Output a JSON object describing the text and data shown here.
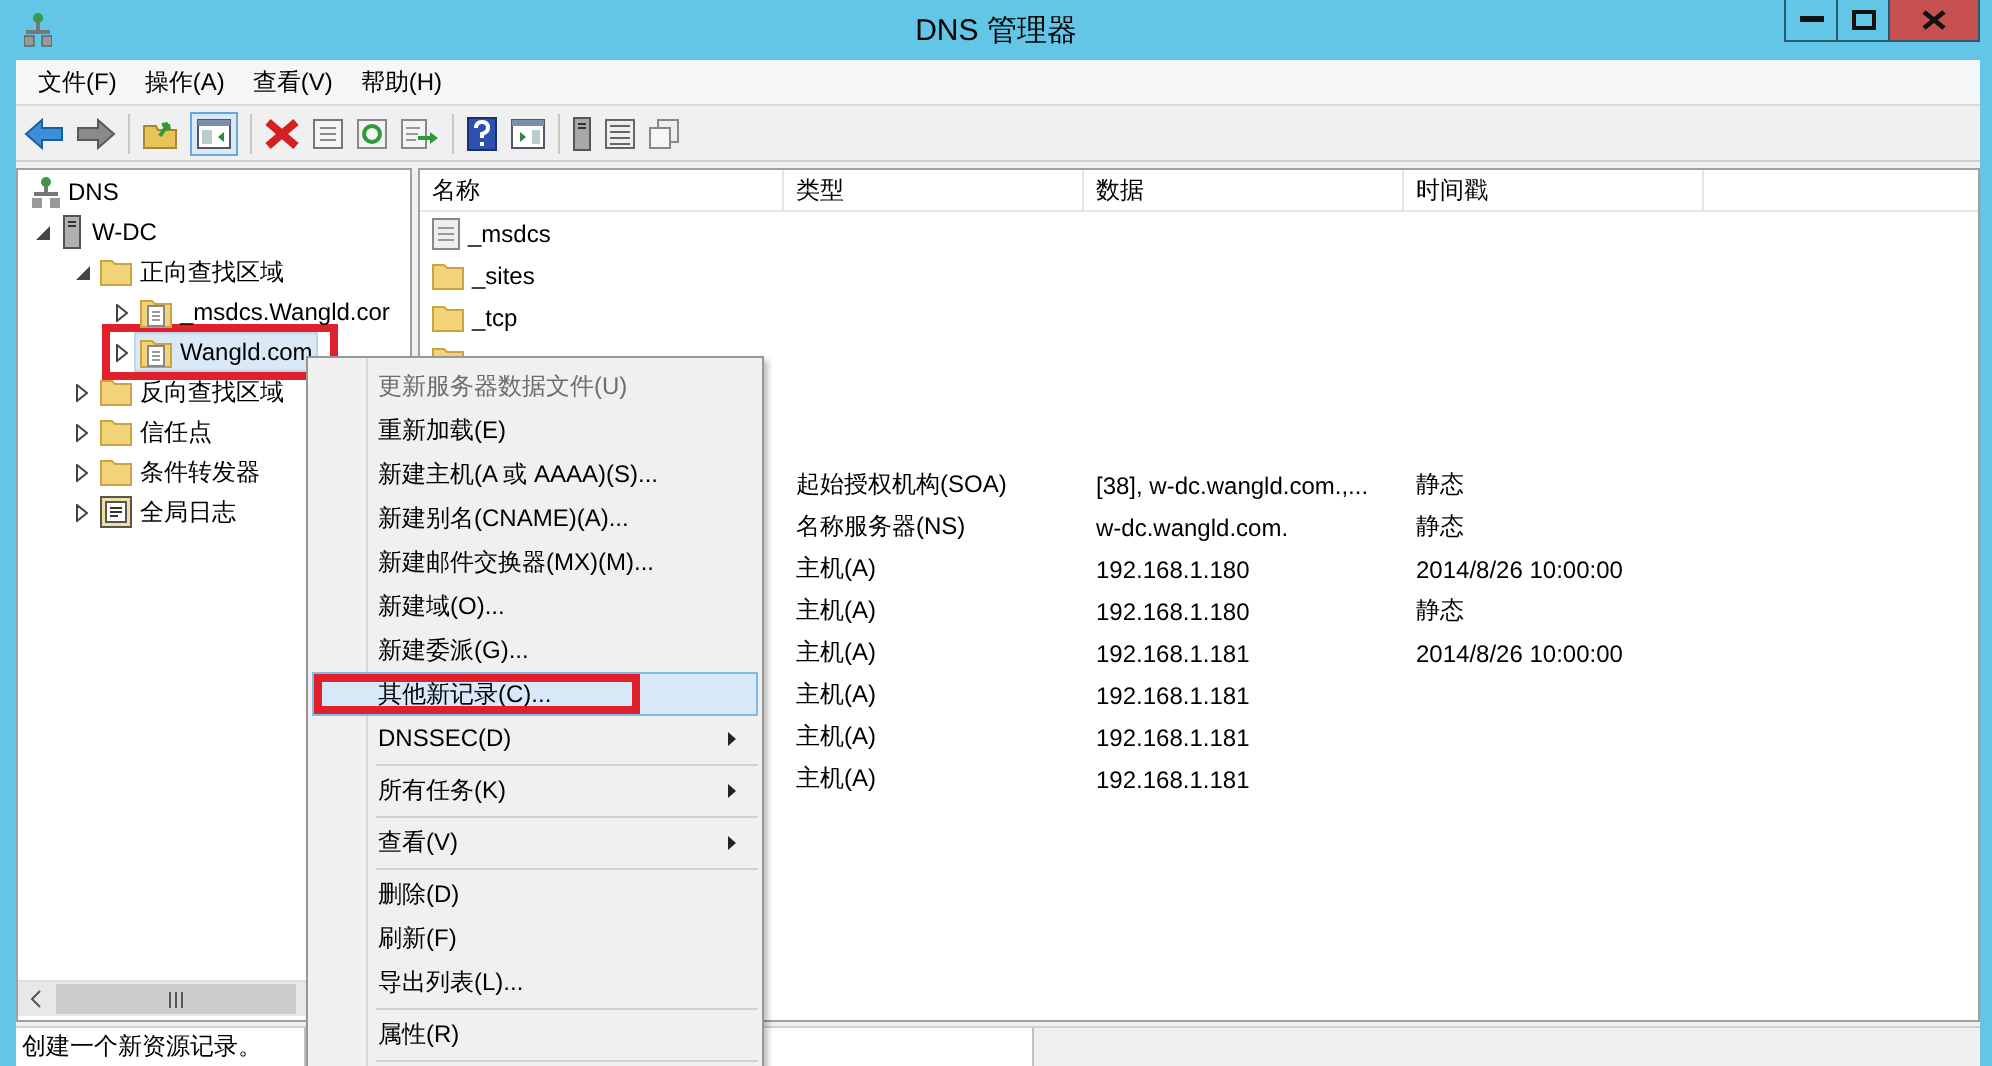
{
  "window": {
    "title": "DNS 管理器"
  },
  "menu_bar": [
    "文件(F)",
    "操作(A)",
    "查看(V)",
    "帮助(H)"
  ],
  "toolbar": {
    "console_tree_shown": true
  },
  "tree": [
    {
      "label": "DNS",
      "kind": "root",
      "selected": false,
      "children": [
        {
          "label": "W-DC",
          "kind": "server",
          "expanded": true,
          "selected": false,
          "children": [
            {
              "label": "正向查找区域",
              "kind": "folder",
              "expanded": true,
              "selected": false,
              "children": [
                {
                  "label": "_msdcs.Wangld.cor",
                  "kind": "zone",
                  "expanded": false,
                  "selected": false,
                  "annotated": false
                },
                {
                  "label": "Wangld.com",
                  "kind": "zone",
                  "expanded": false,
                  "selected": true,
                  "annotated": true
                }
              ]
            },
            {
              "label": "反向查找区域",
              "kind": "folder",
              "expanded": false,
              "selected": false
            },
            {
              "label": "信任点",
              "kind": "folder",
              "expanded": false,
              "selected": false
            },
            {
              "label": "条件转发器",
              "kind": "folder",
              "expanded": false,
              "selected": false
            },
            {
              "label": "全局日志",
              "kind": "log",
              "expanded": false,
              "selected": false
            }
          ]
        }
      ]
    }
  ],
  "list": {
    "columns": [
      "名称",
      "类型",
      "数据",
      "时间戳"
    ],
    "folders": [
      {
        "name": "_msdcs",
        "kind": "zone"
      },
      {
        "name": "_sites",
        "kind": "folder"
      },
      {
        "name": "_tcp",
        "kind": "folder"
      },
      {
        "kind": "folder"
      }
    ],
    "records": [
      {
        "type": "起始授权机构(SOA)",
        "data": "[38], w-dc.wangld.com.,...",
        "timestamp": "静态"
      },
      {
        "type": "名称服务器(NS)",
        "data": "w-dc.wangld.com.",
        "timestamp": "静态"
      },
      {
        "type": "主机(A)",
        "data": "192.168.1.180",
        "timestamp": "2014/8/26 10:00:00"
      },
      {
        "type": "主机(A)",
        "data": "192.168.1.180",
        "timestamp": "静态"
      },
      {
        "type": "主机(A)",
        "data": "192.168.1.181",
        "timestamp": "2014/8/26 10:00:00"
      },
      {
        "type": "主机(A)",
        "data": "192.168.1.181"
      },
      {
        "type": "主机(A)",
        "data": "192.168.1.181"
      },
      {
        "type": "主机(A)",
        "data": "192.168.1.181"
      }
    ]
  },
  "context_menu": {
    "items": [
      {
        "kind": "item",
        "label": "更新服务器数据文件(U)",
        "disabled": true,
        "selected": false,
        "submenu": false,
        "annotated": false
      },
      {
        "kind": "item",
        "label": "重新加载(E)",
        "disabled": false,
        "selected": false,
        "submenu": false,
        "annotated": false
      },
      {
        "kind": "item",
        "label": "新建主机(A 或 AAAA)(S)...",
        "disabled": false,
        "selected": false,
        "submenu": false,
        "annotated": false
      },
      {
        "kind": "item",
        "label": "新建别名(CNAME)(A)...",
        "disabled": false,
        "selected": false,
        "submenu": false,
        "annotated": false
      },
      {
        "kind": "item",
        "label": "新建邮件交换器(MX)(M)...",
        "disabled": false,
        "selected": false,
        "submenu": false,
        "annotated": false
      },
      {
        "kind": "item",
        "label": "新建域(O)...",
        "disabled": false,
        "selected": false,
        "submenu": false,
        "annotated": false
      },
      {
        "kind": "item",
        "label": "新建委派(G)...",
        "disabled": false,
        "selected": false,
        "submenu": false,
        "annotated": false
      },
      {
        "kind": "item",
        "label": "其他新记录(C)...",
        "disabled": false,
        "selected": true,
        "submenu": false,
        "annotated": true
      },
      {
        "kind": "item",
        "label": "DNSSEC(D)",
        "disabled": false,
        "selected": false,
        "submenu": true,
        "annotated": false
      },
      {
        "kind": "separator"
      },
      {
        "kind": "item",
        "label": "所有任务(K)",
        "disabled": false,
        "selected": false,
        "submenu": true,
        "annotated": false
      },
      {
        "kind": "separator"
      },
      {
        "kind": "item",
        "label": "查看(V)",
        "disabled": false,
        "selected": false,
        "submenu": true,
        "annotated": false
      },
      {
        "kind": "separator"
      },
      {
        "kind": "item",
        "label": "删除(D)",
        "disabled": false,
        "selected": false,
        "submenu": false,
        "annotated": false
      },
      {
        "kind": "item",
        "label": "刷新(F)",
        "disabled": false,
        "selected": false,
        "submenu": false,
        "annotated": false
      },
      {
        "kind": "item",
        "label": "导出列表(L)...",
        "disabled": false,
        "selected": false,
        "submenu": false,
        "annotated": false
      },
      {
        "kind": "separator"
      },
      {
        "kind": "item",
        "label": "属性(R)",
        "disabled": false,
        "selected": false,
        "submenu": false,
        "annotated": false
      },
      {
        "kind": "separator"
      }
    ]
  },
  "status_bar": {
    "text": "创建一个新资源记录。"
  }
}
